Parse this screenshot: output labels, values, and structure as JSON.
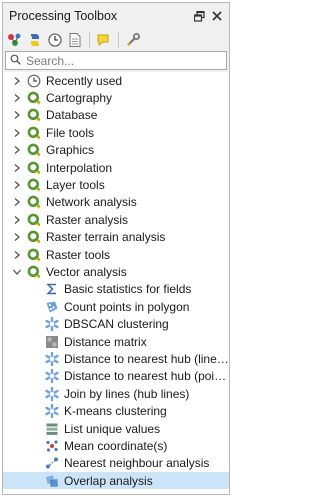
{
  "panel": {
    "title": "Processing Toolbox",
    "float_icon": "float-window-icon",
    "close_icon": "close-icon"
  },
  "toolbar": {
    "tools": [
      {
        "name": "models-icon"
      },
      {
        "name": "scripts-icon"
      },
      {
        "name": "history-icon"
      },
      {
        "name": "results-viewer-icon"
      },
      {
        "name": "edit-features-in-place-icon"
      },
      {
        "name": "options-icon"
      }
    ]
  },
  "search": {
    "placeholder": "Search..."
  },
  "tree": {
    "providers": [
      {
        "label": "Recently used",
        "icon": "clock-icon",
        "expanded": false
      },
      {
        "label": "Cartography",
        "icon": "qgis-icon",
        "expanded": false
      },
      {
        "label": "Database",
        "icon": "qgis-icon",
        "expanded": false
      },
      {
        "label": "File tools",
        "icon": "qgis-icon",
        "expanded": false
      },
      {
        "label": "Graphics",
        "icon": "qgis-icon",
        "expanded": false
      },
      {
        "label": "Interpolation",
        "icon": "qgis-icon",
        "expanded": false
      },
      {
        "label": "Layer tools",
        "icon": "qgis-icon",
        "expanded": false
      },
      {
        "label": "Network analysis",
        "icon": "qgis-icon",
        "expanded": false
      },
      {
        "label": "Raster analysis",
        "icon": "qgis-icon",
        "expanded": false
      },
      {
        "label": "Raster terrain analysis",
        "icon": "qgis-icon",
        "expanded": false
      },
      {
        "label": "Raster tools",
        "icon": "qgis-icon",
        "expanded": false
      },
      {
        "label": "Vector analysis",
        "icon": "qgis-icon",
        "expanded": true
      }
    ],
    "children": [
      {
        "label": "Basic statistics for fields",
        "icon": "sigma-icon"
      },
      {
        "label": "Count points in polygon",
        "icon": "count-points-icon"
      },
      {
        "label": "DBSCAN clustering",
        "icon": "cluster-icon"
      },
      {
        "label": "Distance matrix",
        "icon": "distance-matrix-icon"
      },
      {
        "label": "Distance to nearest hub (line to h...",
        "icon": "hub-icon"
      },
      {
        "label": "Distance to nearest hub (points)",
        "icon": "hub-icon"
      },
      {
        "label": "Join by lines (hub lines)",
        "icon": "hub-icon"
      },
      {
        "label": "K-means clustering",
        "icon": "cluster-icon"
      },
      {
        "label": "List unique values",
        "icon": "unique-values-icon"
      },
      {
        "label": "Mean coordinate(s)",
        "icon": "mean-coordinate-icon"
      },
      {
        "label": "Nearest neighbour analysis",
        "icon": "nearest-neighbour-icon"
      },
      {
        "label": "Overlap analysis",
        "icon": "overlap-icon",
        "selected": true
      }
    ]
  },
  "colors": {
    "selection": "#cce4f7",
    "qgis_green": "#589632",
    "qgis_yellow": "#eec90d"
  }
}
